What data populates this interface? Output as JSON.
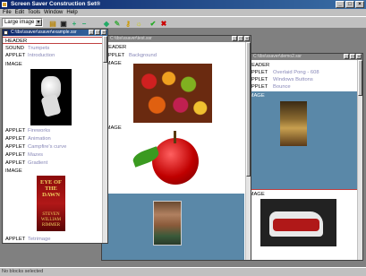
{
  "app": {
    "title": "Screen Saver Construction Set®",
    "menu": [
      "File",
      "Edit",
      "Tools",
      "Window",
      "Help"
    ]
  },
  "toolbar": {
    "combo_value": "Large image",
    "buttons": [
      "open-icon",
      "save-icon",
      "print-icon",
      "add-icon",
      "remove-icon",
      "tag-icon",
      "edit-icon",
      "key-icon",
      "check-icon",
      "delete-icon"
    ]
  },
  "status_text": "No blocks selected",
  "win1": {
    "title": "C:\\tbs\\ssaver\\ssaver\\example.ssr",
    "rows": [
      {
        "tag": "HEADER",
        "val": ""
      },
      {
        "tag": "SOUND",
        "val": "Trumpets"
      },
      {
        "tag": "APPLET",
        "val": "Introduction"
      },
      {
        "tag": "IMAGE",
        "val": ""
      },
      {
        "tag": "APPLET",
        "val": "Fireworks"
      },
      {
        "tag": "APPLET",
        "val": "Animation"
      },
      {
        "tag": "APPLET",
        "val": "Campfire's curve"
      },
      {
        "tag": "APPLET",
        "val": "Mazes"
      },
      {
        "tag": "APPLET",
        "val": "Gradient"
      },
      {
        "tag": "IMAGE",
        "val": ""
      },
      {
        "tag": "APPLET",
        "val": "Tetrimage"
      }
    ],
    "book_title": "EYE OF THE DAWN",
    "book_author": "STEVEN WILLIAM RIMMER"
  },
  "win2": {
    "title": "C:\\tbs\\ssaver\\test.ssr",
    "rows": [
      {
        "tag": "HEADER",
        "val": ""
      },
      {
        "tag": "APPLET",
        "val": "Background"
      },
      {
        "tag": "IMAGE",
        "val": ""
      },
      {
        "tag": "IMAGE",
        "val": ""
      }
    ]
  },
  "win3": {
    "title": "C:\\tbs\\ssaver\\demo2.ssr",
    "rows": [
      {
        "tag": "HEADER",
        "val": ""
      },
      {
        "tag": "APPLET",
        "val": "Overlaid Pong - 608"
      },
      {
        "tag": "APPLET",
        "val": "Windows Buttons"
      },
      {
        "tag": "APPLET",
        "val": "Bounce"
      },
      {
        "tag": "IMAGE",
        "val": ""
      },
      {
        "tag": "IMAGE",
        "val": ""
      }
    ]
  }
}
